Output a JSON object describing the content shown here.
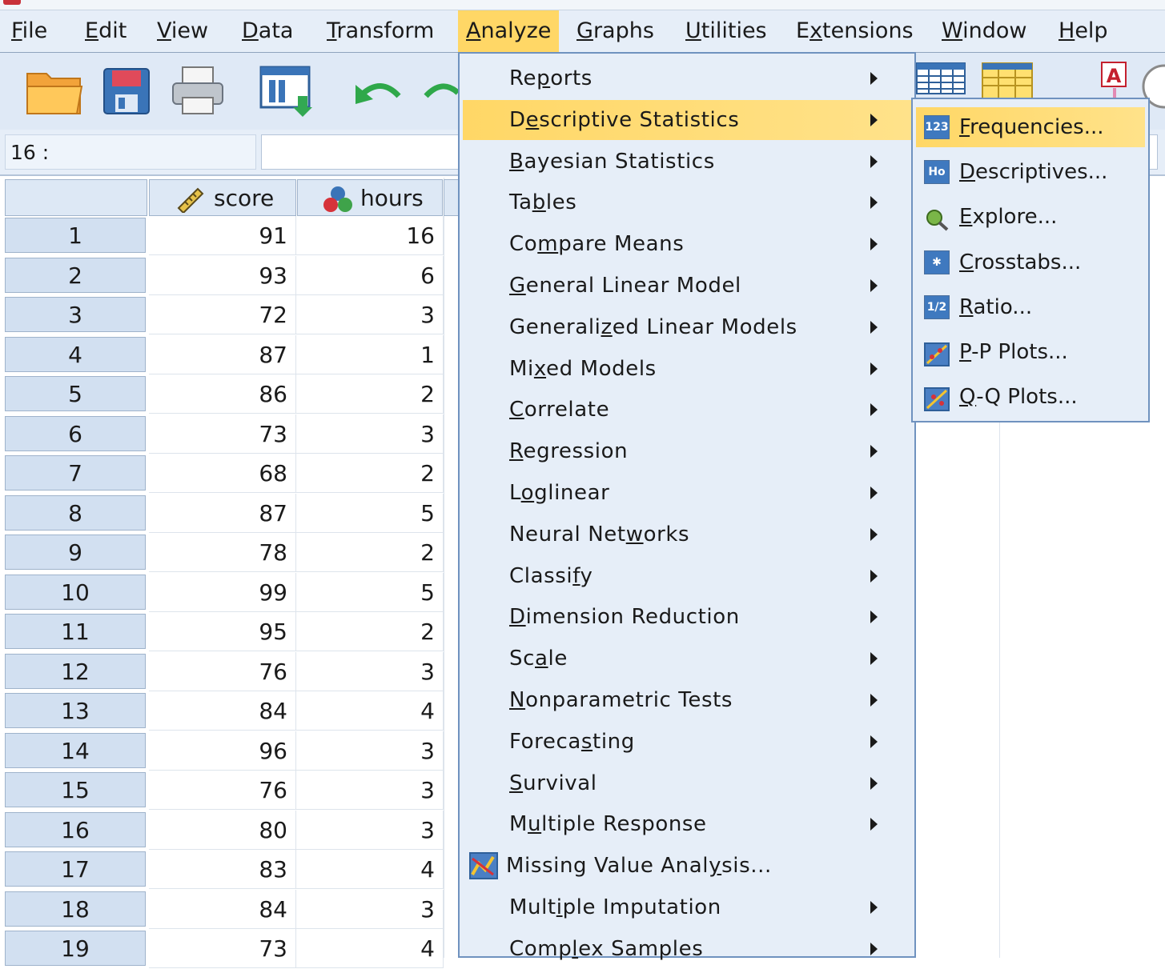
{
  "menubar": {
    "items": [
      {
        "pre": "",
        "u": "F",
        "post": "ile"
      },
      {
        "pre": "",
        "u": "E",
        "post": "dit"
      },
      {
        "pre": "",
        "u": "V",
        "post": "iew"
      },
      {
        "pre": "",
        "u": "D",
        "post": "ata"
      },
      {
        "pre": "",
        "u": "T",
        "post": "ransform"
      },
      {
        "pre": "",
        "u": "A",
        "post": "nalyze"
      },
      {
        "pre": "",
        "u": "G",
        "post": "raphs"
      },
      {
        "pre": "",
        "u": "U",
        "post": "tilities"
      },
      {
        "pre": "E",
        "u": "x",
        "post": "tensions"
      },
      {
        "pre": "",
        "u": "W",
        "post": "indow"
      },
      {
        "pre": "",
        "u": "H",
        "post": "elp"
      }
    ]
  },
  "toolbar": {
    "icons": [
      "open-folder-icon",
      "save-icon",
      "print-icon",
      "recall-dialog-icon",
      "undo-icon",
      "redo-icon",
      "data-grid-icon",
      "value-labels-icon",
      "spell-icon"
    ]
  },
  "editor": {
    "cell_ref": "16 :",
    "cell_value": ""
  },
  "grid": {
    "columns": [
      {
        "name": "score",
        "icon": "ruler-icon"
      },
      {
        "name": "hours",
        "icon": "nominal-balls-icon"
      }
    ],
    "rows": [
      {
        "n": "1",
        "score": "91",
        "hours": "16"
      },
      {
        "n": "2",
        "score": "93",
        "hours": "6"
      },
      {
        "n": "3",
        "score": "72",
        "hours": "3"
      },
      {
        "n": "4",
        "score": "87",
        "hours": "1"
      },
      {
        "n": "5",
        "score": "86",
        "hours": "2"
      },
      {
        "n": "6",
        "score": "73",
        "hours": "3"
      },
      {
        "n": "7",
        "score": "68",
        "hours": "2"
      },
      {
        "n": "8",
        "score": "87",
        "hours": "5"
      },
      {
        "n": "9",
        "score": "78",
        "hours": "2"
      },
      {
        "n": "10",
        "score": "99",
        "hours": "5"
      },
      {
        "n": "11",
        "score": "95",
        "hours": "2"
      },
      {
        "n": "12",
        "score": "76",
        "hours": "3"
      },
      {
        "n": "13",
        "score": "84",
        "hours": "4"
      },
      {
        "n": "14",
        "score": "96",
        "hours": "3"
      },
      {
        "n": "15",
        "score": "76",
        "hours": "3"
      },
      {
        "n": "16",
        "score": "80",
        "hours": "3"
      },
      {
        "n": "17",
        "score": "83",
        "hours": "4"
      },
      {
        "n": "18",
        "score": "84",
        "hours": "3"
      },
      {
        "n": "19",
        "score": "73",
        "hours": "4"
      }
    ]
  },
  "analyze_menu": {
    "items": [
      {
        "pre": "Re",
        "u": "p",
        "post": "orts",
        "arrow": true
      },
      {
        "pre": "D",
        "u": "e",
        "post": "scriptive Statistics",
        "arrow": true,
        "active": true
      },
      {
        "pre": "",
        "u": "B",
        "post": "ayesian Statistics",
        "arrow": true
      },
      {
        "pre": "Ta",
        "u": "b",
        "post": "les",
        "arrow": true
      },
      {
        "pre": "Co",
        "u": "m",
        "post": "pare Means",
        "arrow": true
      },
      {
        "pre": "",
        "u": "G",
        "post": "eneral Linear Model",
        "arrow": true
      },
      {
        "pre": "Generali",
        "u": "z",
        "post": "ed Linear Models",
        "arrow": true
      },
      {
        "pre": "Mi",
        "u": "x",
        "post": "ed Models",
        "arrow": true
      },
      {
        "pre": "",
        "u": "C",
        "post": "orrelate",
        "arrow": true
      },
      {
        "pre": "",
        "u": "R",
        "post": "egression",
        "arrow": true
      },
      {
        "pre": "L",
        "u": "o",
        "post": "glinear",
        "arrow": true
      },
      {
        "pre": "Neural Net",
        "u": "w",
        "post": "orks",
        "arrow": true
      },
      {
        "pre": "Classi",
        "u": "f",
        "post": "y",
        "arrow": true
      },
      {
        "pre": "",
        "u": "D",
        "post": "imension Reduction",
        "arrow": true
      },
      {
        "pre": "Sc",
        "u": "a",
        "post": "le",
        "arrow": true
      },
      {
        "pre": "",
        "u": "N",
        "post": "onparametric Tests",
        "arrow": true
      },
      {
        "pre": "Foreca",
        "u": "s",
        "post": "ting",
        "arrow": true
      },
      {
        "pre": "",
        "u": "S",
        "post": "urvival",
        "arrow": true
      },
      {
        "pre": "M",
        "u": "u",
        "post": "ltiple Response",
        "arrow": true
      },
      {
        "pre": "Missing Value Anal",
        "u": "y",
        "post": "sis...",
        "arrow": false,
        "icon": "missing-value-icon"
      },
      {
        "pre": "Mult",
        "u": "i",
        "post": "ple Imputation",
        "arrow": true
      },
      {
        "pre": "Comp",
        "u": "l",
        "post": "ex Samples",
        "arrow": true
      }
    ]
  },
  "desc_submenu": {
    "items": [
      {
        "pre": "",
        "u": "F",
        "post": "requencies...",
        "icon": "123",
        "icon_name": "frequencies-icon",
        "active": true
      },
      {
        "pre": "",
        "u": "D",
        "post": "escriptives...",
        "icon": "Ho",
        "icon_name": "descriptives-icon"
      },
      {
        "pre": "",
        "u": "E",
        "post": "xplore...",
        "icon": "",
        "icon_name": "explore-icon"
      },
      {
        "pre": "",
        "u": "C",
        "post": "rosstabs...",
        "icon": "✱",
        "icon_name": "crosstabs-icon"
      },
      {
        "pre": "",
        "u": "R",
        "post": "atio...",
        "icon": "1/2",
        "icon_name": "ratio-icon"
      },
      {
        "pre": "",
        "u": "P",
        "post": "-P Plots...",
        "icon": "",
        "icon_name": "pp-plots-icon"
      },
      {
        "pre": "",
        "u": "Q",
        "post": "-Q Plots...",
        "icon": "",
        "icon_name": "qq-plots-icon"
      }
    ]
  }
}
